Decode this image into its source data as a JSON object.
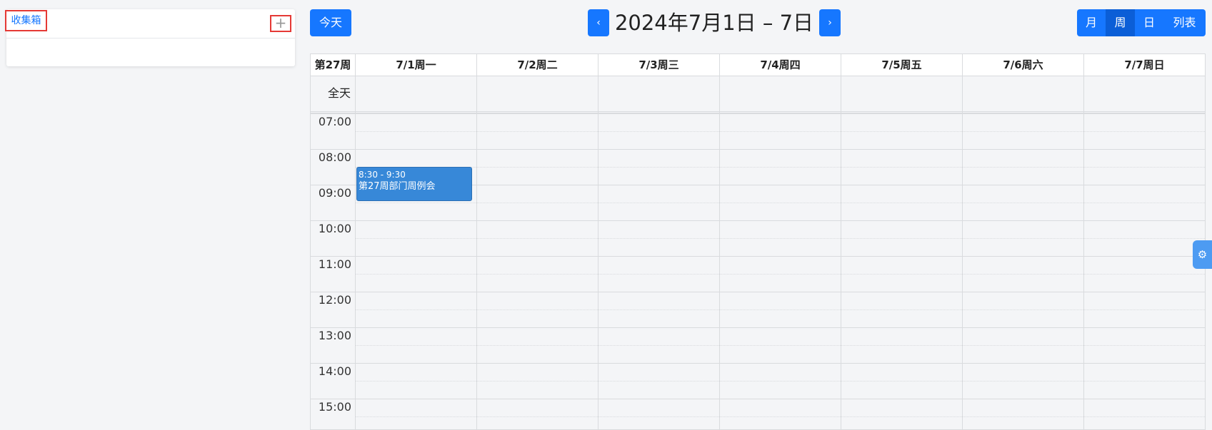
{
  "sidebar": {
    "inbox_tab": "收集箱",
    "add_icon": "plus-icon",
    "add_symbol": "+"
  },
  "toolbar": {
    "today": "今天",
    "prev": "‹",
    "next": "›",
    "range_title": "2024年7月1日 – 7日",
    "views": [
      {
        "label": "月",
        "active": false
      },
      {
        "label": "周",
        "active": true
      },
      {
        "label": "日",
        "active": false
      },
      {
        "label": "列表",
        "active": false
      }
    ]
  },
  "calendar": {
    "week_label": "第27周",
    "allday_label": "全天",
    "days": [
      "7/1周一",
      "7/2周二",
      "7/3周三",
      "7/4周四",
      "7/5周五",
      "7/6周六",
      "7/7周日"
    ],
    "times": [
      "07:00",
      "08:00",
      "09:00",
      "10:00",
      "11:00",
      "12:00",
      "13:00",
      "14:00",
      "15:00"
    ],
    "events": [
      {
        "time": "8:30 - 9:30",
        "title": "第27周部门周例会",
        "day": "7/1周一",
        "start": "8:30",
        "end": "9:30"
      }
    ]
  },
  "settings": {
    "icon": "gear-icon",
    "symbol": "⚙"
  },
  "colors": {
    "accent": "#1677ff",
    "event": "#3788d8",
    "highlight": "#e53935"
  }
}
